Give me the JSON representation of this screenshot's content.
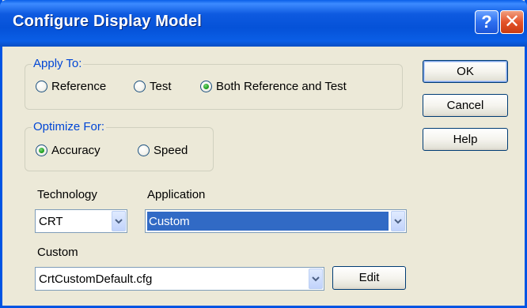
{
  "window": {
    "title": "Configure Display Model",
    "help_glyph": "?",
    "close_glyph": "✕"
  },
  "apply_to": {
    "label": "Apply To:",
    "options": [
      {
        "label": "Reference",
        "checked": false
      },
      {
        "label": "Test",
        "checked": false
      },
      {
        "label": "Both Reference and Test",
        "checked": true
      }
    ]
  },
  "optimize_for": {
    "label": "Optimize For:",
    "options": [
      {
        "label": "Accuracy",
        "checked": true
      },
      {
        "label": "Speed",
        "checked": false
      }
    ]
  },
  "technology": {
    "label": "Technology",
    "value": "CRT"
  },
  "application": {
    "label": "Application",
    "value": "Custom"
  },
  "custom": {
    "label": "Custom",
    "value": "CrtCustomDefault.cfg",
    "edit_label": "Edit"
  },
  "buttons": {
    "ok": "OK",
    "cancel": "Cancel",
    "help": "Help"
  },
  "colors": {
    "titlebar": "#0552d8",
    "group_label": "#0046d5",
    "selection": "#316ac5",
    "radio_dot": "#21a121"
  }
}
